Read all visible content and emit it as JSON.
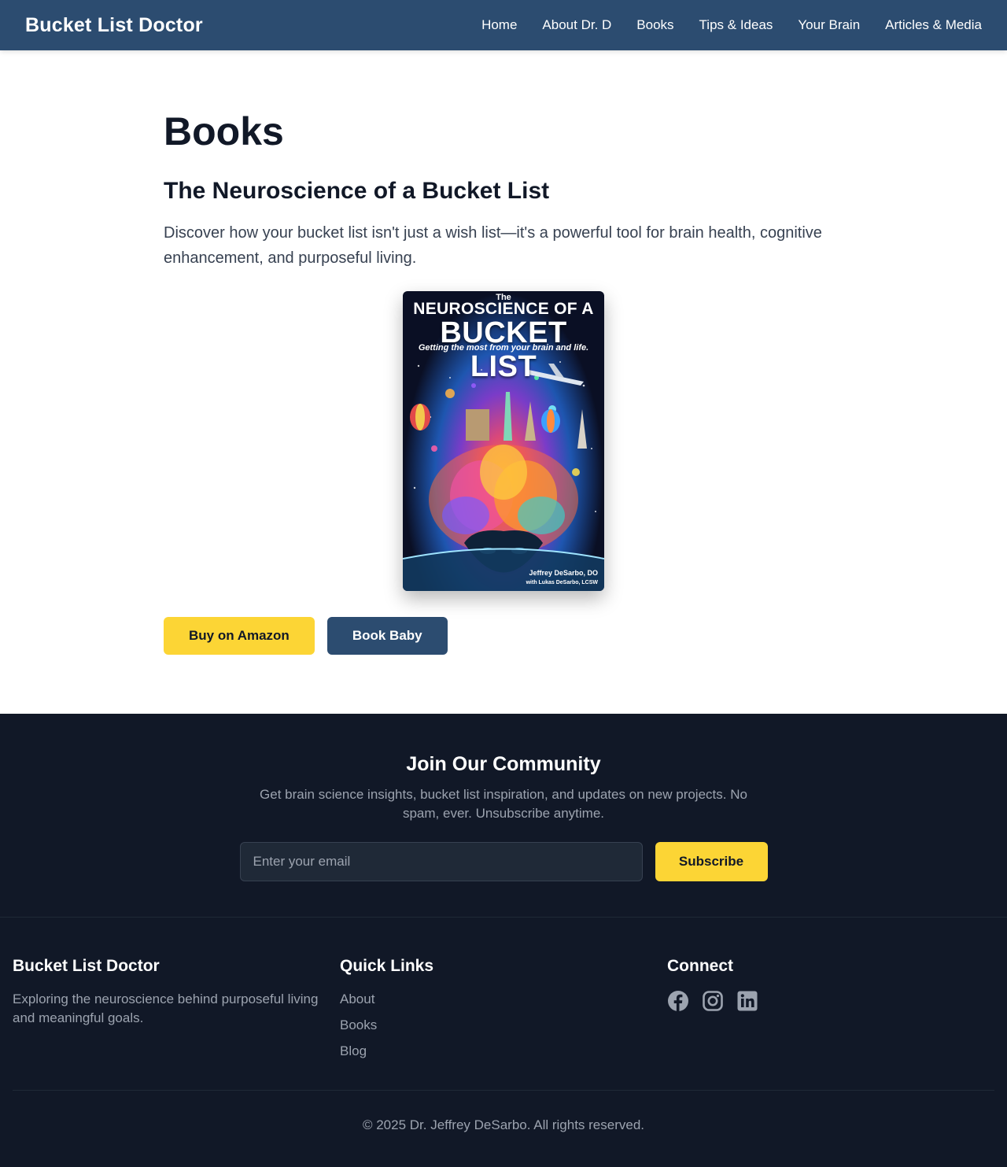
{
  "header": {
    "brand": "Bucket List Doctor",
    "nav": [
      "Home",
      "About Dr. D",
      "Books",
      "Tips & Ideas",
      "Your Brain",
      "Articles & Media"
    ]
  },
  "main": {
    "page_title": "Books",
    "book_title": "The Neuroscience of a Bucket List",
    "description": "Discover how your bucket list isn't just a wish list—it's a powerful tool for brain health, cognitive enhancement, and purposeful living.",
    "cover": {
      "line1": "The",
      "line2": "NEUROSCIENCE OF A",
      "line3": "BUCKET LIST",
      "tagline": "Getting the most from your brain and life.",
      "author": "Jeffrey DeSarbo, DO",
      "coauthor": "with Lukas DeSarbo, LCSW"
    },
    "buttons": {
      "amazon": "Buy on Amazon",
      "bookbaby": "Book Baby"
    }
  },
  "newsletter": {
    "title": "Join Our Community",
    "description": "Get brain science insights, bucket list inspiration, and updates on new projects. No spam, ever. Unsubscribe anytime.",
    "placeholder": "Enter your email",
    "button": "Subscribe"
  },
  "footer": {
    "brand_title": "Bucket List Doctor",
    "brand_text": "Exploring the neuroscience behind purposeful living and meaningful goals.",
    "links_title": "Quick Links",
    "links": [
      "About",
      "Books",
      "Blog"
    ],
    "connect_title": "Connect",
    "social": [
      "facebook-icon",
      "instagram-icon",
      "linkedin-icon"
    ],
    "copyright": "© 2025 Dr. Jeffrey DeSarbo. All rights reserved."
  },
  "colors": {
    "header_bg": "#2c4c70",
    "accent_yellow": "#fcd535",
    "footer_bg": "#111827"
  }
}
